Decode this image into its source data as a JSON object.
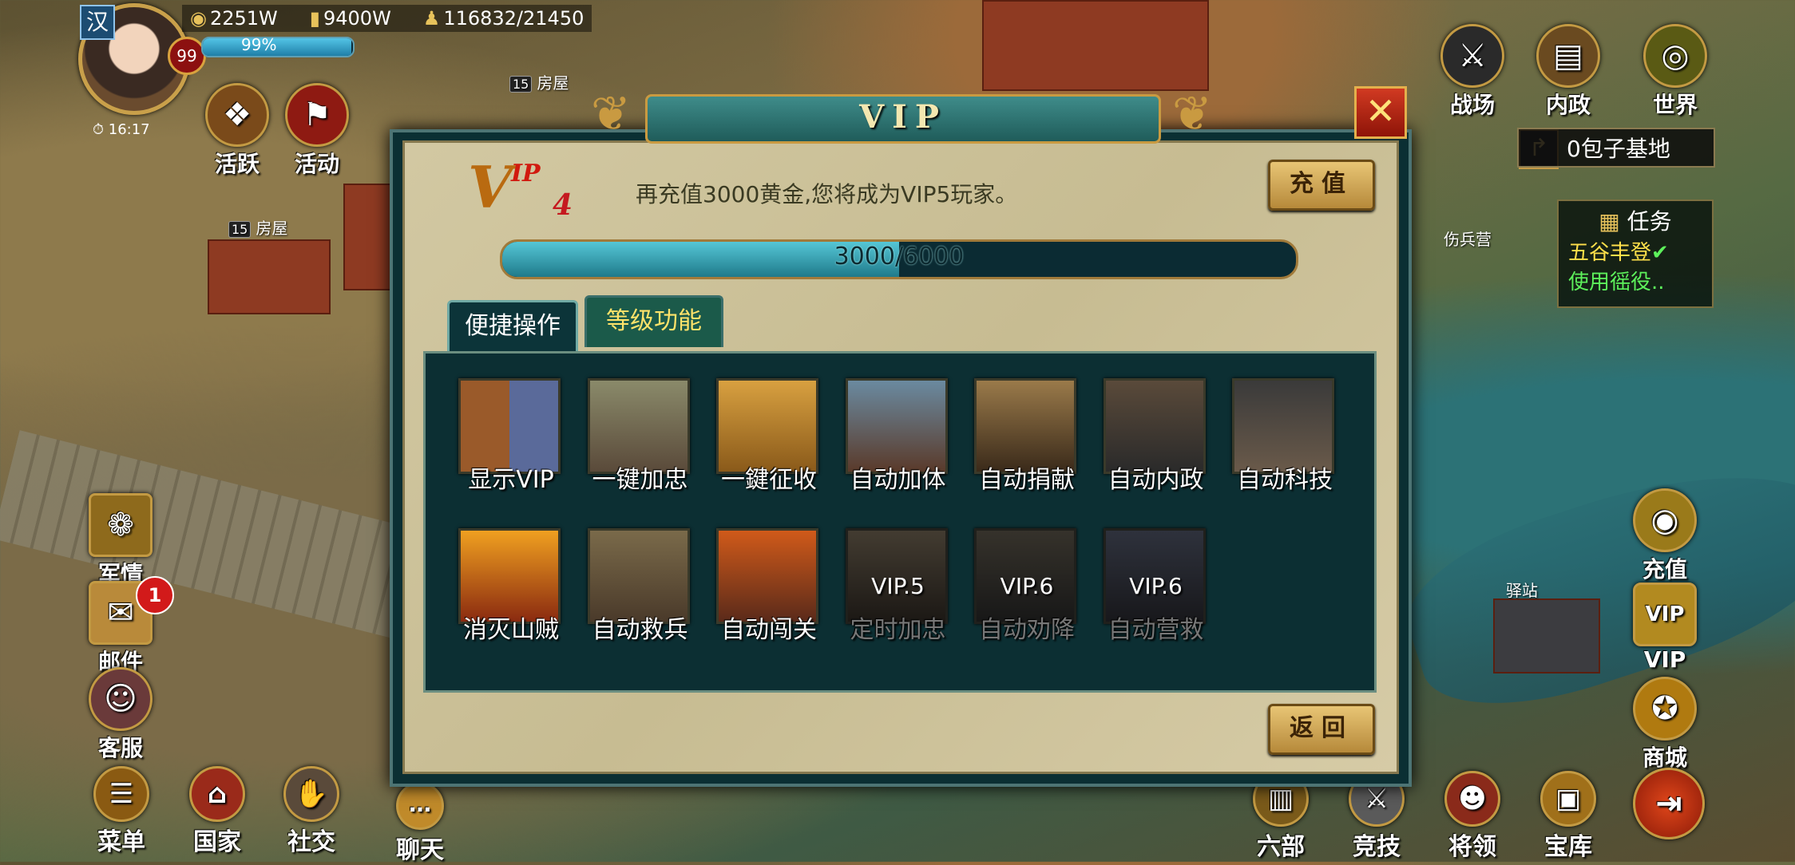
{
  "hud": {
    "nation": "汉",
    "level": "99",
    "gold": "2251W",
    "food": "9400W",
    "troops": "116832/21450",
    "exp_percent": "99%",
    "exp_fraction": 0.99,
    "clock": "16:17"
  },
  "map_labels": {
    "house1": "房屋",
    "house1_level": "15",
    "house2": "房屋",
    "house2_level": "15",
    "hospital": "伤兵营",
    "station": "驿站"
  },
  "top_left_buttons": [
    {
      "label": "活跃",
      "icon": "chest-icon"
    },
    {
      "label": "活动",
      "icon": "flag-icon"
    }
  ],
  "top_right_buttons": [
    {
      "label": "战场",
      "icon": "crossed-swords-icon"
    },
    {
      "label": "内政",
      "icon": "scroll-icon"
    },
    {
      "label": "世界",
      "icon": "world-icon"
    }
  ],
  "location": "0包子基地",
  "tasks": {
    "title": "任务",
    "items": [
      {
        "text": "五谷丰登",
        "done": true
      },
      {
        "text": "使用徭役..",
        "done": false
      }
    ]
  },
  "left_buttons": [
    {
      "label": "军情",
      "icon": "military-report-icon"
    },
    {
      "label": "邮件",
      "icon": "mail-icon",
      "badge": "1"
    },
    {
      "label": "客服",
      "icon": "support-icon"
    }
  ],
  "right_buttons": [
    {
      "label": "充值",
      "icon": "coin-icon"
    },
    {
      "label": "VIP",
      "icon": "vip-icon"
    },
    {
      "label": "商城",
      "icon": "shop-icon"
    }
  ],
  "bottom_buttons": [
    {
      "label": "菜单",
      "icon": "menu-icon"
    },
    {
      "label": "国家",
      "icon": "country-icon"
    },
    {
      "label": "社交",
      "icon": "social-icon"
    },
    {
      "label": "聊天",
      "icon": "chat-icon"
    },
    {
      "label": "六部",
      "icon": "ministry-icon"
    },
    {
      "label": "竞技",
      "icon": "arena-icon"
    },
    {
      "label": "将领",
      "icon": "general-icon"
    },
    {
      "label": "宝库",
      "icon": "treasury-icon"
    }
  ],
  "vip_dialog": {
    "title": "VIP",
    "logo_v": "V",
    "logo_ip": "IP",
    "vip_level": "4",
    "message": "再充值3000黄金,您将成为VIP5玩家。",
    "recharge_button": "充值",
    "progress_text": "3000/6000",
    "progress_fraction": 0.5,
    "tabs": [
      {
        "label": "便捷操作",
        "active": true
      },
      {
        "label": "等级功能",
        "active": false
      }
    ],
    "features": [
      {
        "label": "显示VIP",
        "locked": false,
        "lock_text": ""
      },
      {
        "label": "一键加忠",
        "locked": false,
        "lock_text": ""
      },
      {
        "label": "一鍵征收",
        "locked": false,
        "lock_text": ""
      },
      {
        "label": "自动加体",
        "locked": false,
        "lock_text": ""
      },
      {
        "label": "自动捐献",
        "locked": false,
        "lock_text": ""
      },
      {
        "label": "自动内政",
        "locked": false,
        "lock_text": ""
      },
      {
        "label": "自动科技",
        "locked": false,
        "lock_text": ""
      },
      {
        "label": "消灭山贼",
        "locked": false,
        "lock_text": ""
      },
      {
        "label": "自动救兵",
        "locked": false,
        "lock_text": ""
      },
      {
        "label": "自动闯关",
        "locked": false,
        "lock_text": ""
      },
      {
        "label": "定时加忠",
        "locked": true,
        "lock_text": "VIP.5"
      },
      {
        "label": "自动劝降",
        "locked": true,
        "lock_text": "VIP.6"
      },
      {
        "label": "自动营救",
        "locked": true,
        "lock_text": "VIP.6"
      }
    ],
    "back_button": "返回"
  },
  "colors": {
    "accent_gold": "#c99a41",
    "panel_teal": "#0c2f33",
    "task_yellow": "#ffe04a",
    "task_green": "#5df05b"
  }
}
